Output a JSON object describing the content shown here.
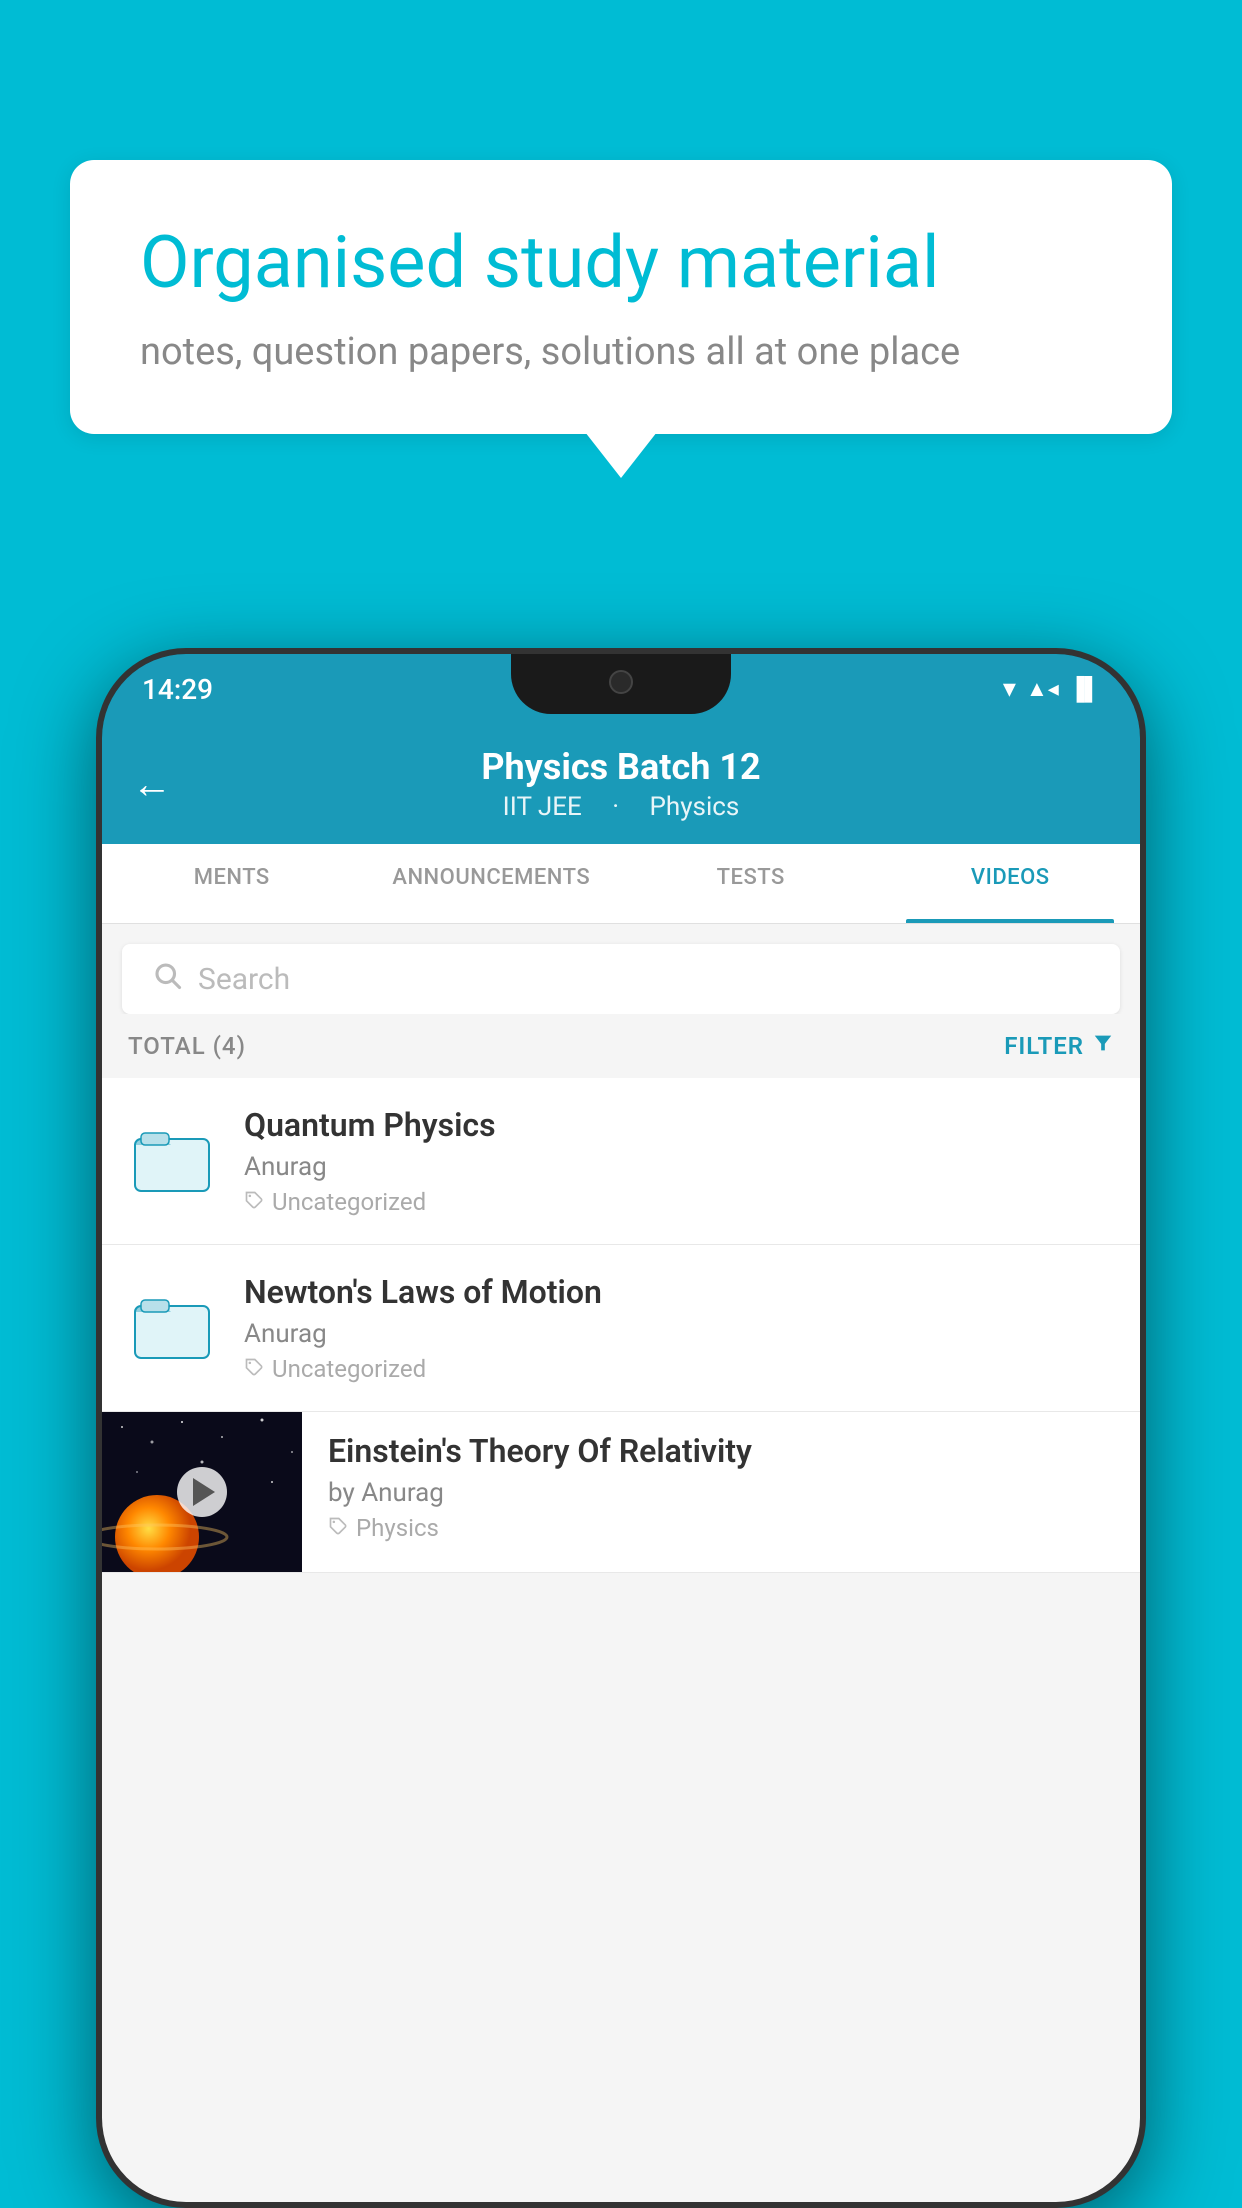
{
  "background_color": "#00BCD4",
  "bubble": {
    "title": "Organised study material",
    "subtitle": "notes, question papers, solutions all at one place"
  },
  "status_bar": {
    "time": "14:29",
    "wifi": "▼",
    "signal": "▲",
    "battery": "▐"
  },
  "header": {
    "title": "Physics Batch 12",
    "tag1": "IIT JEE",
    "tag2": "Physics",
    "back_label": "←"
  },
  "tabs": [
    {
      "label": "MENTS",
      "active": false
    },
    {
      "label": "ANNOUNCEMENTS",
      "active": false
    },
    {
      "label": "TESTS",
      "active": false
    },
    {
      "label": "VIDEOS",
      "active": true
    }
  ],
  "search": {
    "placeholder": "Search"
  },
  "filter_bar": {
    "total_label": "TOTAL (4)",
    "filter_label": "FILTER"
  },
  "videos": [
    {
      "id": 1,
      "title": "Quantum Physics",
      "author": "Anurag",
      "tag": "Uncategorized",
      "has_thumb": false
    },
    {
      "id": 2,
      "title": "Newton's Laws of Motion",
      "author": "Anurag",
      "tag": "Uncategorized",
      "has_thumb": false
    },
    {
      "id": 3,
      "title": "Einstein's Theory Of Relativity",
      "author": "by Anurag",
      "tag": "Physics",
      "has_thumb": true
    }
  ]
}
